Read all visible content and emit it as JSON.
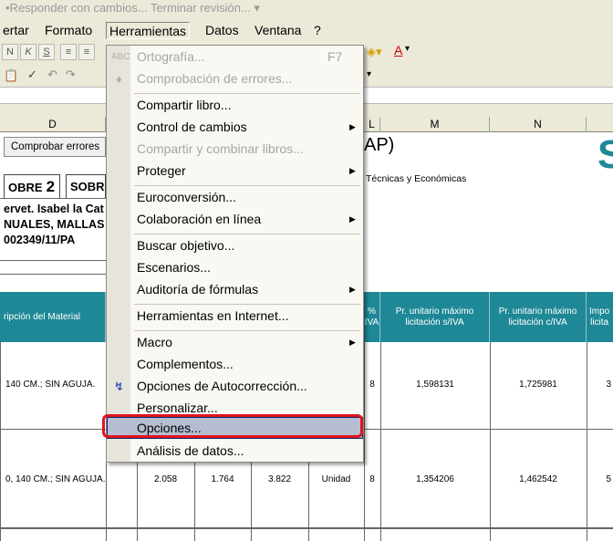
{
  "review_bar": {
    "text": "•Responder con cambios...  Terminar revisión... ▾"
  },
  "menubar": {
    "items": [
      "ertar",
      "Formato",
      "Herramientas",
      "Datos",
      "Ventana",
      "?"
    ]
  },
  "column_headers": [
    "D",
    "L",
    "M",
    "N"
  ],
  "sheet": {
    "button_label": "Comprobar errores",
    "title_fragment": "AP)",
    "subtitle_fragment": "Técnicas y Económicas",
    "logo_fragment": "S",
    "tabs": [
      {
        "label": "OBRE",
        "num": "2"
      },
      {
        "label": "SOBR",
        "num": ""
      }
    ],
    "info_lines": [
      "ervet. Isabel la Cat",
      "NUALES, MALLAS",
      "002349/11/PA"
    ],
    "table_headers": {
      "desc": "ripción del Material",
      "iva_pct": "%\nIVA",
      "pu_siva": "Pr. unitario máximo\nlicitación s/IVA",
      "pu_civa": "Pr. unitario máximo\nlicitación c/IVA",
      "importe": "Impo\nlicita"
    },
    "rows": [
      {
        "desc": "140 CM.; SIN AGUJA.",
        "q1": "",
        "q2": "",
        "q3": "",
        "unit": "",
        "iva": "8",
        "pu_siva": "1,598131",
        "pu_civa": "1,725981",
        "imp": "3"
      },
      {
        "desc": "0, 140 CM.; SIN AGUJA.",
        "q1": "2.058",
        "q2": "1.764",
        "q3": "3.822",
        "unit": "Unidad",
        "iva": "8",
        "pu_siva": "1,354206",
        "pu_civa": "1,462542",
        "imp": "5"
      }
    ]
  },
  "tools_menu": {
    "items": [
      {
        "label": "Ortografía...",
        "shortcut": "F7",
        "disabled": true,
        "icon": "spelling-icon"
      },
      {
        "label": "Comprobación de errores...",
        "disabled": true,
        "icon": "error-check-icon"
      },
      {
        "label": "Compartir libro...",
        "sep_before": true
      },
      {
        "label": "Control de cambios",
        "submenu": true
      },
      {
        "label": "Compartir y combinar libros...",
        "disabled": true
      },
      {
        "label": "Proteger",
        "submenu": true
      },
      {
        "label": "Euroconversión...",
        "sep_before": true
      },
      {
        "label": "Colaboración en línea",
        "submenu": true
      },
      {
        "label": "Buscar objetivo...",
        "sep_before": true
      },
      {
        "label": "Escenarios..."
      },
      {
        "label": "Auditoría de fórmulas",
        "submenu": true
      },
      {
        "label": "Herramientas en Internet...",
        "sep_before": true
      },
      {
        "label": "Macro",
        "submenu": true,
        "sep_before": true
      },
      {
        "label": "Complementos..."
      },
      {
        "label": "Opciones de Autocorrección...",
        "icon": "autocorrect-icon"
      },
      {
        "label": "Personalizar..."
      },
      {
        "label": "Opciones...",
        "highlighted": true
      },
      {
        "label": "Análisis de datos..."
      }
    ]
  },
  "colors": {
    "table_header": "#1f8897",
    "highlight_box": "#e0141e",
    "logo": "#1f8897"
  }
}
